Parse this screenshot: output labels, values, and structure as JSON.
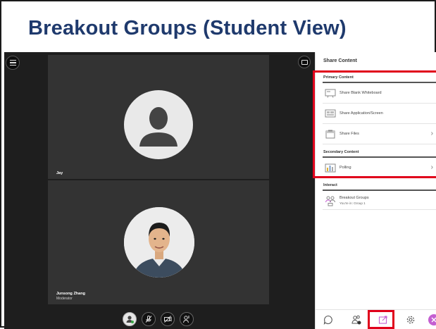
{
  "slide": {
    "title": "Breakout Groups (Student View)"
  },
  "video": {
    "participants": [
      {
        "name": "Jay",
        "role": ""
      },
      {
        "name": "Junsong Zhang",
        "role": "Moderator"
      }
    ],
    "icons": {
      "menu": "hamburger-menu-icon",
      "layout": "layout-icon"
    }
  },
  "controls": [
    "avatar",
    "microphone-muted",
    "camera-off",
    "raise-hand"
  ],
  "panel": {
    "title": "Share Content",
    "primary_heading": "Primary Content",
    "primary_items": [
      {
        "label": "Share Blank Whiteboard",
        "icon": "whiteboard-icon"
      },
      {
        "label": "Share Application/Screen",
        "icon": "screen-share-icon"
      },
      {
        "label": "Share Files",
        "icon": "file-icon"
      }
    ],
    "secondary_heading": "Secondary Content",
    "secondary_items": [
      {
        "label": "Polling",
        "icon": "poll-icon"
      }
    ],
    "interact_heading": "Interact",
    "breakout": {
      "title": "Breakout Groups",
      "subtitle": "You're in: Group 1"
    },
    "bottom_tabs": [
      "chat-icon",
      "attendees-icon",
      "share-icon",
      "settings-icon",
      "close-icon"
    ]
  },
  "colors": {
    "title": "#1f3a6d",
    "highlight": "#e0001b",
    "close_button": "#c45fd1",
    "video_bg": "#1e1e1e",
    "tile_bg": "#333333"
  }
}
